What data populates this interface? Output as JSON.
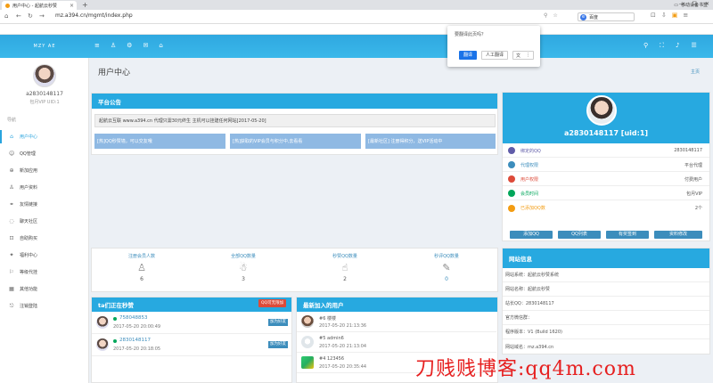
{
  "browser": {
    "tab_title": "用户中心 - 起航云秒赞",
    "tab_close": "×",
    "new_tab": "+",
    "url": "mz.a394.cn/mgmt/index.php",
    "search_engine": "百度",
    "bookmark_right": "移动设备书签",
    "nav": [
      "←",
      "→",
      "↻",
      "⌂"
    ]
  },
  "translate_popup": {
    "question": "要翻译此页吗？",
    "translate_btn": "翻译",
    "manual_btn": "人工翻译",
    "more": "⋮"
  },
  "header": {
    "logo": "MZY AE"
  },
  "sidebar": {
    "username": "a2830148117",
    "vip": "包月VIP UID:1",
    "nav_label": "导航",
    "items": [
      {
        "label": "用户中心",
        "icon": "home-icon",
        "active": true
      },
      {
        "label": "QQ管理",
        "icon": "qq-icon"
      },
      {
        "label": "新加应用",
        "icon": "plus-icon"
      },
      {
        "label": "用户资料",
        "icon": "user-icon"
      },
      {
        "label": "友情链接",
        "icon": "link-icon"
      },
      {
        "label": "聊天社区",
        "icon": "chat-icon"
      },
      {
        "label": "自助购买",
        "icon": "cart-icon"
      },
      {
        "label": "福利中心",
        "icon": "gift-icon"
      },
      {
        "label": "等级代挂",
        "icon": "level-icon"
      },
      {
        "label": "其他功能",
        "icon": "grid-icon"
      },
      {
        "label": "注销登陆",
        "icon": "logout-icon"
      }
    ]
  },
  "main": {
    "page_title": "用户中心",
    "home_link": "主页",
    "notice": {
      "title": "平台公告",
      "text": "起航云互联 www.a394.cn 代理只需30元终生 主机可以挂建任何网站[2017-05-20]",
      "buttons": [
        "[热]QQ秒赞墙，可以交友哦",
        "[热]获取的VIP会员与积分中,去看看",
        "[最新社区] 注册得积分，送VIP活动中"
      ]
    },
    "stats": [
      {
        "label": "注册会员人数",
        "value": "6",
        "icon": "user-icon"
      },
      {
        "label": "全部QQ数量",
        "value": "3",
        "icon": "qq-icon"
      },
      {
        "label": "秒赞QQ数量",
        "value": "2",
        "icon": "thumbs-up-icon"
      },
      {
        "label": "秒评QQ数量",
        "value": "0",
        "icon": "edit-icon"
      }
    ],
    "online": {
      "title": "ta们正在秒赞",
      "badge": "QQ可无限加",
      "rows": [
        {
          "qq": "758048853",
          "time": "2017-05-20 20:00:49",
          "tag": "加为好友"
        },
        {
          "qq": "2830148117",
          "time": "2017-05-20 20:18:05",
          "tag": "加为好友"
        }
      ]
    },
    "new_users": {
      "title": "最新加入的用户",
      "rows": [
        {
          "name": "#6 楼楼",
          "time": "2017-05-20 21:13:36"
        },
        {
          "name": "#5 admin6",
          "time": "2017-05-20 21:13:04"
        },
        {
          "name": "#4 123456",
          "time": "2017-05-20 20:35:44"
        }
      ]
    }
  },
  "profile": {
    "name": "a2830148117 [uid:1]",
    "rows": [
      {
        "label": "绑定的QQ",
        "value": "2830148117",
        "color": "#605ca8"
      },
      {
        "label": "代理权限",
        "value": "平台代理",
        "color": "#3c8dbc"
      },
      {
        "label": "用户权限",
        "value": "付费用户",
        "color": "#dd4b39"
      },
      {
        "label": "会员时间",
        "value": "包月VIP",
        "color": "#00a65a"
      },
      {
        "label": "已添加QQ数",
        "value": "2个",
        "color": "#f39c12"
      }
    ],
    "buttons": [
      "添加QQ",
      "QQ列表",
      "有奖签到",
      "资料修改"
    ]
  },
  "site_info": {
    "title": "网站信息",
    "rows": [
      "网站系统：起航云秒赞系统",
      "网站名称：起航云秒赞",
      "站长QQ：2830148117",
      "官方微信群：",
      "程序版本：V1 (Build 1620)",
      "网站域名：mz.a394.cn"
    ]
  },
  "watermark": "刀贱贱博客:qq4m.com"
}
